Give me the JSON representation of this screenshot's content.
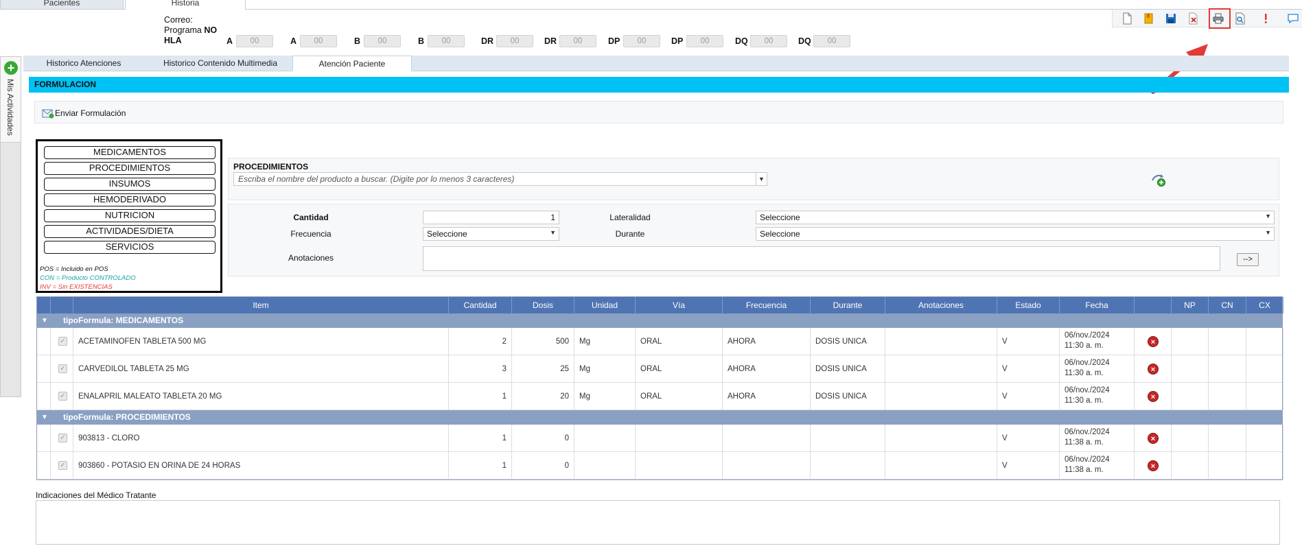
{
  "top_tabs": [
    {
      "label": "Pacientes"
    },
    {
      "label": "Historia"
    }
  ],
  "patient": {
    "correo_label": "Correo:",
    "programa_label": "Programa",
    "programa_value": "NO",
    "hla_label": "HLA",
    "hla": [
      {
        "label": "A",
        "value": "00"
      },
      {
        "label": "A",
        "value": "00"
      },
      {
        "label": "B",
        "value": "00"
      },
      {
        "label": "B",
        "value": "00"
      },
      {
        "label": "DR",
        "value": "00"
      },
      {
        "label": "DR",
        "value": "00"
      },
      {
        "label": "DP",
        "value": "00"
      },
      {
        "label": "DP",
        "value": "00"
      },
      {
        "label": "DQ",
        "value": "00"
      },
      {
        "label": "DQ",
        "value": "00"
      }
    ]
  },
  "toolbar": {
    "icons": [
      "new-document-icon",
      "bookmark-icon",
      "save-icon",
      "delete-document-icon",
      "print-icon",
      "preview-icon",
      "alert-icon",
      "chat-icon"
    ],
    "highlight_color": "#e53935"
  },
  "side_panel": {
    "label": "Mis Actividades"
  },
  "sub_tabs": [
    {
      "label": "Historico Atenciones"
    },
    {
      "label": "Historico Contenido Multimedia"
    },
    {
      "label": "Atención Paciente"
    }
  ],
  "section": {
    "title": "FORMULACION",
    "color": "#00c1f3",
    "send_label": "Enviar Formulación"
  },
  "type_buttons": [
    {
      "label": "MEDICAMENTOS"
    },
    {
      "label": "PROCEDIMIENTOS"
    },
    {
      "label": "INSUMOS"
    },
    {
      "label": "HEMODERIVADO"
    },
    {
      "label": "NUTRICION"
    },
    {
      "label": "ACTIVIDADES/DIETA"
    },
    {
      "label": "SERVICIOS"
    }
  ],
  "legend": {
    "pos": "POS = Incluido en POS",
    "con": "CON = Producto CONTROLADO",
    "inv": "INV = Sin EXISTENCIAS"
  },
  "search": {
    "title": "PROCEDIMIENTOS",
    "placeholder": "Escriba el nombre del producto a buscar. (Digite por lo menos 3 caracteres)"
  },
  "details": {
    "cantidad_label": "Cantidad",
    "cantidad_value": "1",
    "lateralidad_label": "Lateralidad",
    "lateralidad_value": "Seleccione",
    "frecuencia_label": "Frecuencia",
    "frecuencia_value": "Seleccione",
    "durante_label": "Durante",
    "durante_value": "Seleccione",
    "anotaciones_label": "Anotaciones",
    "anotaciones_value": "",
    "next_label": "-->"
  },
  "grid": {
    "columns": [
      "Item",
      "Cantidad",
      "Dosis",
      "Unidad",
      "Vía",
      "Frecuencia",
      "Durante",
      "Anotaciones",
      "Estado",
      "Fecha",
      "",
      "NP",
      "CN",
      "CX"
    ],
    "groups": [
      {
        "label": "tipoFormula: MEDICAMENTOS",
        "rows": [
          {
            "item": "ACETAMINOFEN TABLETA 500 MG",
            "cantidad": "2",
            "dosis": "500",
            "unidad": "Mg",
            "via": "ORAL",
            "frecuencia": "AHORA",
            "durante": "DOSIS UNICA",
            "anotaciones": "",
            "estado": "V",
            "fecha1": "06/nov./2024",
            "fecha2": "11:30 a. m."
          },
          {
            "item": "CARVEDILOL TABLETA 25 MG",
            "cantidad": "3",
            "dosis": "25",
            "unidad": "Mg",
            "via": "ORAL",
            "frecuencia": "AHORA",
            "durante": "DOSIS UNICA",
            "anotaciones": "",
            "estado": "V",
            "fecha1": "06/nov./2024",
            "fecha2": "11:30 a. m."
          },
          {
            "item": "ENALAPRIL MALEATO TABLETA 20 MG",
            "cantidad": "1",
            "dosis": "20",
            "unidad": "Mg",
            "via": "ORAL",
            "frecuencia": "AHORA",
            "durante": "DOSIS UNICA",
            "anotaciones": "",
            "estado": "V",
            "fecha1": "06/nov./2024",
            "fecha2": "11:30 a. m."
          }
        ]
      },
      {
        "label": "tipoFormula: PROCEDIMIENTOS",
        "rows": [
          {
            "item": "903813 - CLORO",
            "cantidad": "1",
            "dosis": "0",
            "unidad": "",
            "via": "",
            "frecuencia": "",
            "durante": "",
            "anotaciones": "",
            "estado": "V",
            "fecha1": "06/nov./2024",
            "fecha2": "11:38 a. m."
          },
          {
            "item": "903860 - POTASIO EN ORINA DE 24 HORAS",
            "cantidad": "1",
            "dosis": "0",
            "unidad": "",
            "via": "",
            "frecuencia": "",
            "durante": "",
            "anotaciones": "",
            "estado": "V",
            "fecha1": "06/nov./2024",
            "fecha2": "11:38 a. m."
          }
        ]
      }
    ]
  },
  "indicaciones": {
    "label": "Indicaciones del Médico Tratante",
    "value": ""
  }
}
